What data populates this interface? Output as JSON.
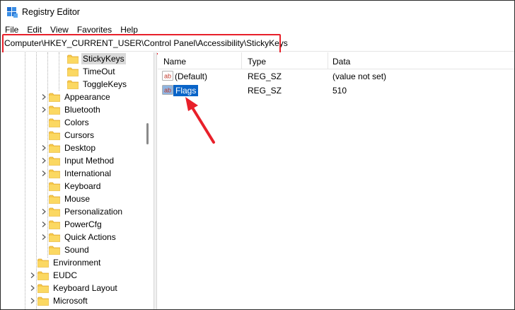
{
  "window": {
    "title": "Registry Editor",
    "icon": "registry-editor-icon"
  },
  "menu": {
    "items": [
      {
        "label": "File",
        "name": "menu-file"
      },
      {
        "label": "Edit",
        "name": "menu-edit"
      },
      {
        "label": "View",
        "name": "menu-view"
      },
      {
        "label": "Favorites",
        "name": "menu-favorites"
      },
      {
        "label": "Help",
        "name": "menu-help"
      }
    ]
  },
  "address": {
    "path": "Computer\\HKEY_CURRENT_USER\\Control Panel\\Accessibility\\StickyKeys",
    "highlight_color": "#e8202a"
  },
  "tree": {
    "nodes": [
      {
        "label": "StickyKeys",
        "level": 2,
        "expandable": false,
        "selected": true
      },
      {
        "label": "TimeOut",
        "level": 2,
        "expandable": false,
        "selected": false
      },
      {
        "label": "ToggleKeys",
        "level": 2,
        "expandable": false,
        "selected": false
      },
      {
        "label": "Appearance",
        "level": 1,
        "expandable": true,
        "selected": false
      },
      {
        "label": "Bluetooth",
        "level": 1,
        "expandable": true,
        "selected": false
      },
      {
        "label": "Colors",
        "level": 1,
        "expandable": false,
        "selected": false
      },
      {
        "label": "Cursors",
        "level": 1,
        "expandable": false,
        "selected": false
      },
      {
        "label": "Desktop",
        "level": 1,
        "expandable": true,
        "selected": false
      },
      {
        "label": "Input Method",
        "level": 1,
        "expandable": true,
        "selected": false
      },
      {
        "label": "International",
        "level": 1,
        "expandable": true,
        "selected": false
      },
      {
        "label": "Keyboard",
        "level": 1,
        "expandable": false,
        "selected": false
      },
      {
        "label": "Mouse",
        "level": 1,
        "expandable": false,
        "selected": false
      },
      {
        "label": "Personalization",
        "level": 1,
        "expandable": true,
        "selected": false
      },
      {
        "label": "PowerCfg",
        "level": 1,
        "expandable": true,
        "selected": false
      },
      {
        "label": "Quick Actions",
        "level": 1,
        "expandable": true,
        "selected": false
      },
      {
        "label": "Sound",
        "level": 1,
        "expandable": false,
        "selected": false
      },
      {
        "label": "Environment",
        "level": 0,
        "expandable": false,
        "selected": false
      },
      {
        "label": "EUDC",
        "level": 0,
        "expandable": true,
        "selected": false
      },
      {
        "label": "Keyboard Layout",
        "level": 0,
        "expandable": true,
        "selected": false
      },
      {
        "label": "Microsoft",
        "level": 0,
        "expandable": true,
        "selected": false
      }
    ]
  },
  "list": {
    "columns": {
      "name": "Name",
      "type": "Type",
      "data": "Data"
    },
    "rows": [
      {
        "name": "(Default)",
        "type": "REG_SZ",
        "data": "(value not set)",
        "icon": "string-value-icon",
        "selected": false
      },
      {
        "name": "Flags",
        "type": "REG_SZ",
        "data": "510",
        "icon": "string-value-icon",
        "selected": true
      }
    ]
  },
  "annotation": {
    "arrow_color": "#e8202a"
  },
  "colors": {
    "selection": "#0a64c8",
    "folder": "#f7c94a",
    "folder_dark": "#e0a82a"
  }
}
